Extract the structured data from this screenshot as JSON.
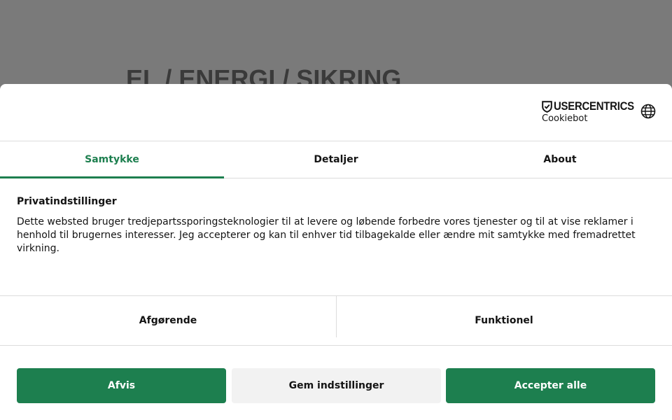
{
  "background": {
    "heading": "EL / ENERGI / SIKRING"
  },
  "header": {
    "brand_name": "USERCENTRICS",
    "brand_sub": "Cookiebot",
    "language_icon": "globe-icon"
  },
  "tabs": [
    {
      "label": "Samtykke",
      "active": true
    },
    {
      "label": "Detaljer",
      "active": false
    },
    {
      "label": "About",
      "active": false
    }
  ],
  "consent": {
    "title": "Privatindstillinger",
    "text": "Dette websted bruger tredjepartssporingsteknologier til at levere og løbende forbedre vores tjenester og til at vise reklamer i henhold til brugernes interesser. Jeg accepterer og kan til enhver tid tilbagekalde eller ændre mit samtykke med fremadrettet virkning."
  },
  "categories": [
    {
      "label": "Afgørende"
    },
    {
      "label": "Funktionel"
    }
  ],
  "buttons": {
    "reject": "Afvis",
    "save": "Gem indstillinger",
    "accept": "Accepter alle"
  },
  "colors": {
    "accent": "#1d7f4f",
    "overlay": "#7a7a7a",
    "secondary_button": "#f2f2f2"
  }
}
